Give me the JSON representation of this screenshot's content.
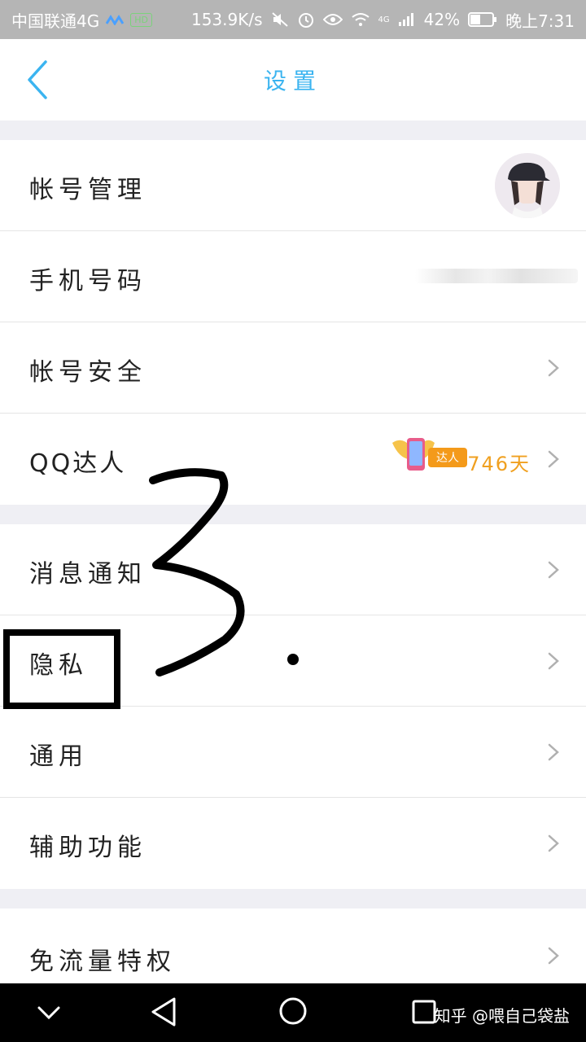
{
  "status_bar": {
    "carrier": "中国联通4G",
    "hd_chip": "HD",
    "speed": "153.9K/s",
    "network": "4G",
    "battery": "42%",
    "time": "晚上7:31"
  },
  "header": {
    "title": "设置"
  },
  "settings_groups": [
    {
      "items": [
        {
          "label": "帐号管理"
        },
        {
          "label": "手机号码"
        },
        {
          "label": "帐号安全"
        },
        {
          "label": "QQ达人",
          "badge": "达人",
          "days": "746天"
        }
      ]
    },
    {
      "items": [
        {
          "label": "消息通知"
        },
        {
          "label": "隐私"
        },
        {
          "label": "通用"
        },
        {
          "label": "辅助功能"
        }
      ]
    },
    {
      "items": [
        {
          "label": "免流量特权"
        }
      ]
    }
  ],
  "annotation": {
    "handwritten": "3."
  },
  "watermark": "知乎 @喂自己袋盐",
  "icons": [
    "back-icon",
    "chevron-right-icon",
    "avatar",
    "qq-daren-badge-icon",
    "back-triangle-icon",
    "home-circle-icon",
    "recents-square-icon",
    "collapse-chevron-icon"
  ],
  "colors": {
    "accent": "#3bb4f0",
    "daren_orange": "#f0a020"
  }
}
